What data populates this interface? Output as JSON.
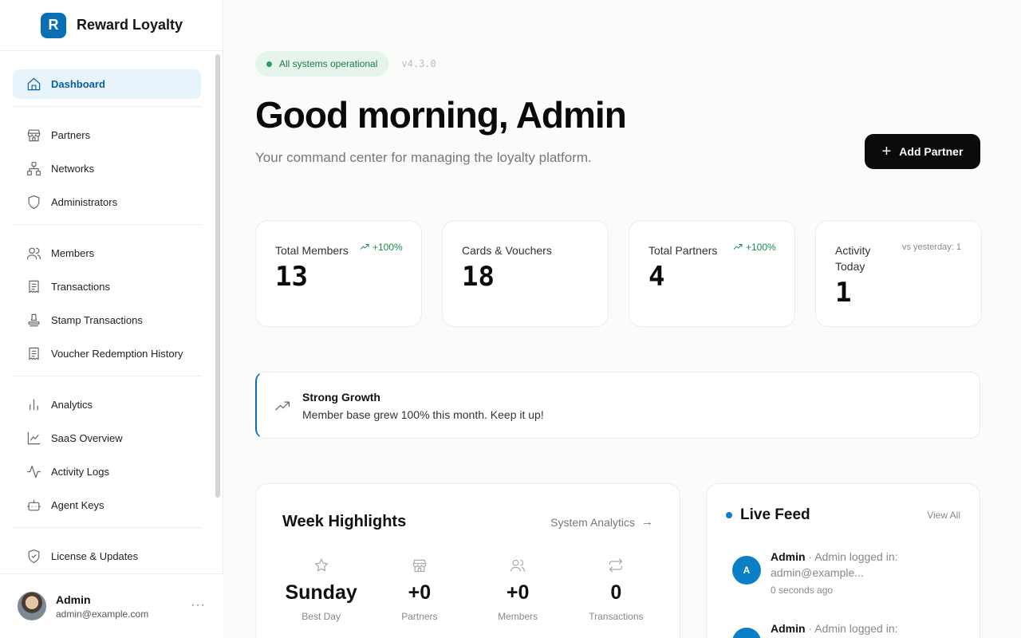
{
  "brand": {
    "logo_letter": "R",
    "name": "Reward Loyalty",
    "color": "#0b6fb5"
  },
  "sidebar": {
    "groups": [
      [
        {
          "label": "Dashboard",
          "icon": "home-icon",
          "active": true
        }
      ],
      [
        {
          "label": "Partners",
          "icon": "store-icon"
        },
        {
          "label": "Networks",
          "icon": "network-icon"
        },
        {
          "label": "Administrators",
          "icon": "shield-icon"
        }
      ],
      [
        {
          "label": "Members",
          "icon": "users-icon"
        },
        {
          "label": "Transactions",
          "icon": "receipt-icon"
        },
        {
          "label": "Stamp Transactions",
          "icon": "stamp-icon"
        },
        {
          "label": "Voucher Redemption History",
          "icon": "receipt-icon"
        }
      ],
      [
        {
          "label": "Analytics",
          "icon": "bar-chart-icon"
        },
        {
          "label": "SaaS Overview",
          "icon": "line-chart-icon"
        },
        {
          "label": "Activity Logs",
          "icon": "activity-icon"
        },
        {
          "label": "Agent Keys",
          "icon": "bot-icon"
        }
      ],
      [
        {
          "label": "License & Updates",
          "icon": "shield-check-icon"
        }
      ]
    ]
  },
  "user": {
    "name": "Admin",
    "email": "admin@example.com",
    "more": "···"
  },
  "status": {
    "label": "All systems operational",
    "version": "v4.3.0",
    "color": "#22a35a"
  },
  "hero": {
    "title": "Good morning, Admin",
    "subtitle": "Your command center for managing the loyalty platform."
  },
  "actions": {
    "add_partner": "Add Partner",
    "add_icon": "+"
  },
  "stats": [
    {
      "label": "Total Members",
      "value": "13",
      "trend": "+100%"
    },
    {
      "label": "Cards & Vouchers",
      "value": "18"
    },
    {
      "label": "Total Partners",
      "value": "4",
      "trend": "+100%"
    },
    {
      "label": "Activity Today",
      "value": "1",
      "note": "vs yesterday: 1"
    }
  ],
  "insight": {
    "title": "Strong Growth",
    "text": "Member base grew 100% this month. Keep it up!"
  },
  "week": {
    "title": "Week Highlights",
    "link": "System Analytics",
    "link_arrow": "→",
    "items": [
      {
        "value": "Sunday",
        "label": "Best Day",
        "icon": "star-icon"
      },
      {
        "value": "+0",
        "label": "Partners",
        "icon": "store-icon"
      },
      {
        "value": "+0",
        "label": "Members",
        "icon": "users-icon"
      },
      {
        "value": "0",
        "label": "Transactions",
        "icon": "repeat-icon"
      }
    ]
  },
  "feed": {
    "title": "Live Feed",
    "view_all": "View All",
    "items": [
      {
        "avatar": "A",
        "actor": "Admin",
        "text": " · Admin logged in: admin@example...",
        "time": "0 seconds ago"
      },
      {
        "avatar": "A",
        "actor": "Admin",
        "text": " · Admin logged in:",
        "time": ""
      }
    ]
  }
}
